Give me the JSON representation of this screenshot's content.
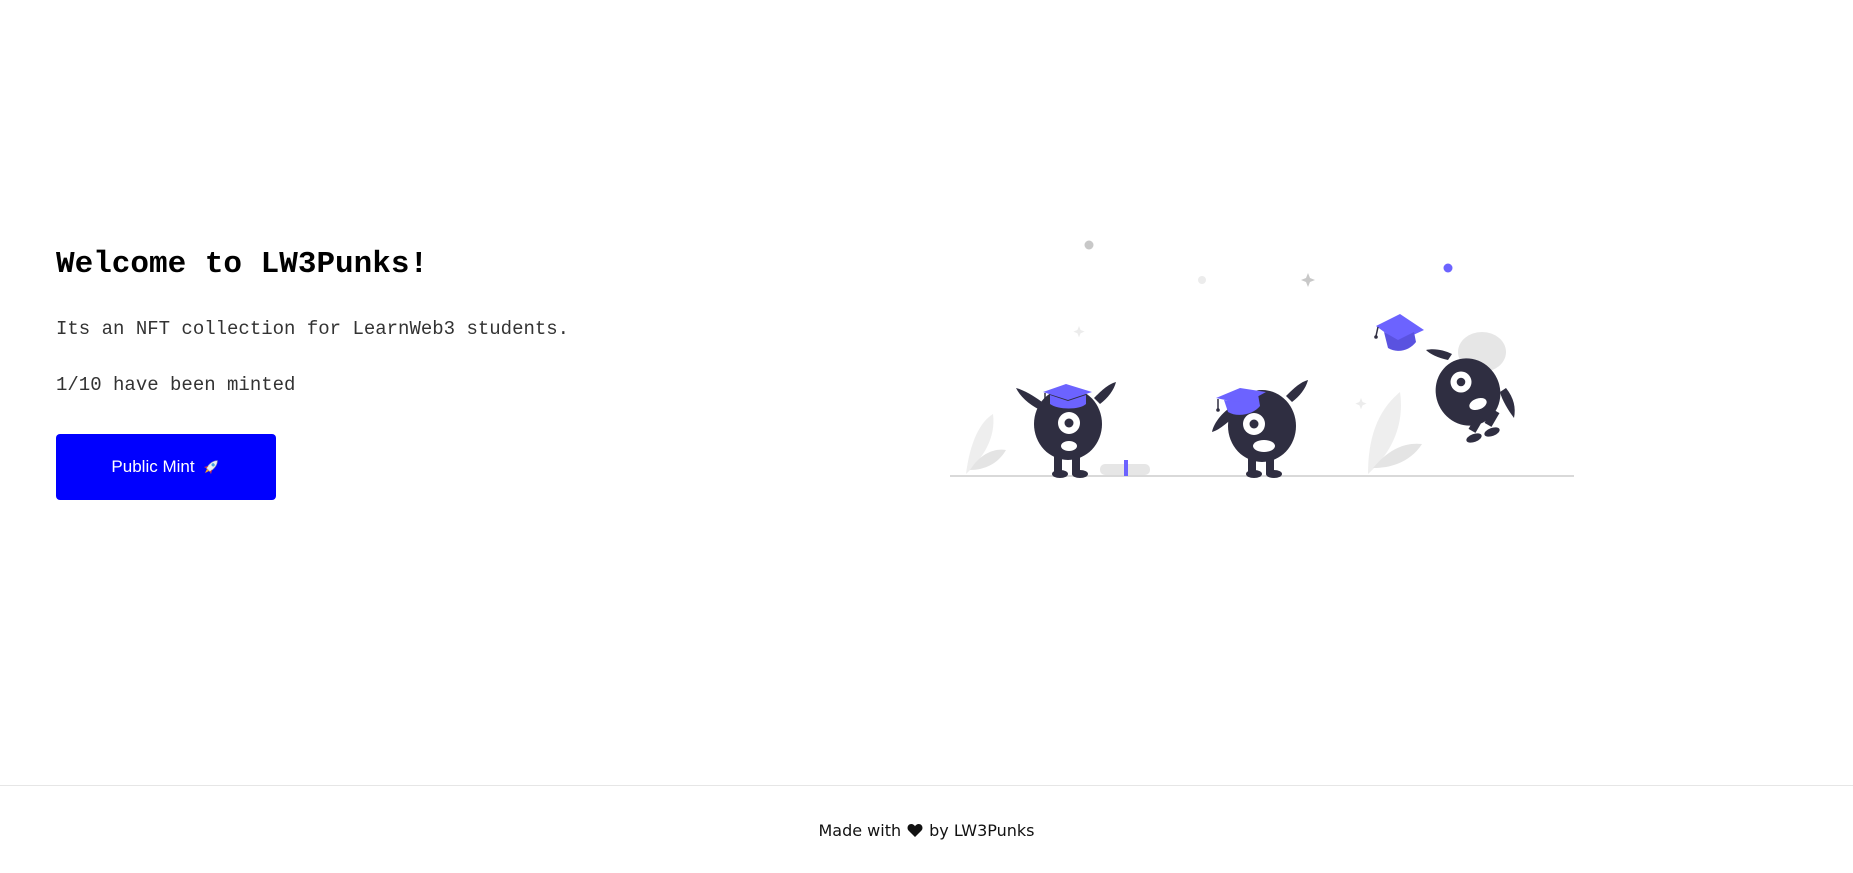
{
  "hero": {
    "title": "Welcome to LW3Punks!",
    "description": "Its an NFT collection for LearnWeb3 students.",
    "minted_count": "1/10",
    "minted_suffix": " have been minted"
  },
  "mint_button": {
    "label": "Public Mint",
    "icon": "rocket-icon",
    "background": "#0000ff"
  },
  "illustration": {
    "name": "graduation-monsters-illustration",
    "accent_color": "#6c63ff",
    "body_color": "#2f2e41"
  },
  "footer": {
    "prefix": "Made with",
    "icon": "heart-icon",
    "suffix": "by LW3Punks"
  }
}
